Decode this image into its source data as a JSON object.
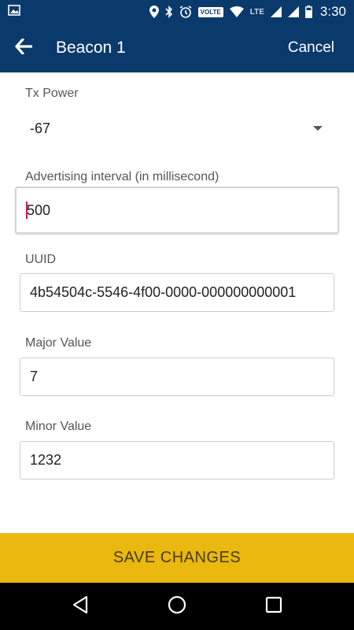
{
  "status_bar": {
    "time": "3:30",
    "volte_label": "VOLTE",
    "lte_label": "LTE",
    "icons": [
      "image-icon",
      "location-icon",
      "bluetooth-icon",
      "alarm-icon",
      "wifi-icon",
      "signal-icon",
      "signal-icon",
      "battery-icon"
    ]
  },
  "app_bar": {
    "title": "Beacon 1",
    "cancel_label": "Cancel"
  },
  "form": {
    "tx_power": {
      "label": "Tx Power",
      "value": "-67"
    },
    "advertising_interval": {
      "label": "Advertising interval (in millisecond)",
      "value": "500"
    },
    "uuid": {
      "label": "UUID",
      "value": "4b54504c-5546-4f00-0000-000000000001"
    },
    "major": {
      "label": "Major Value",
      "value": "7"
    },
    "minor": {
      "label": "Minor Value",
      "value": "1232"
    }
  },
  "save_label": "SAVE CHANGES",
  "colors": {
    "app_bar": "#0a3a6c",
    "save_button": "#eab80e",
    "cursor": "#c2185b"
  }
}
